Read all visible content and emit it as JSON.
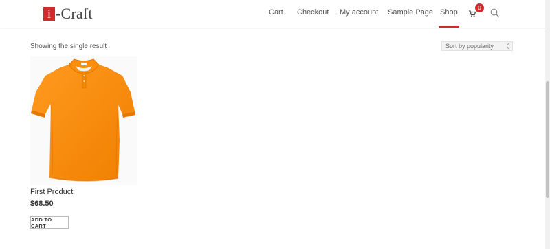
{
  "header": {
    "logo_mark": "i",
    "logo_text": "-Craft",
    "nav": [
      "Cart",
      "Checkout",
      "My account",
      "Sample Page",
      "Shop"
    ],
    "active_nav": "Shop",
    "cart_count": "0",
    "icons": {
      "cart": "cart-icon",
      "search": "search-icon"
    },
    "colors": {
      "accent": "#d42a2a"
    }
  },
  "shop": {
    "result_count": "Showing the single result",
    "sort_selected": "Sort by popularity"
  },
  "products": [
    {
      "title": "First Product",
      "price": "$68.50",
      "button": "ADD TO CART",
      "image": "orange polo shirt"
    }
  ]
}
